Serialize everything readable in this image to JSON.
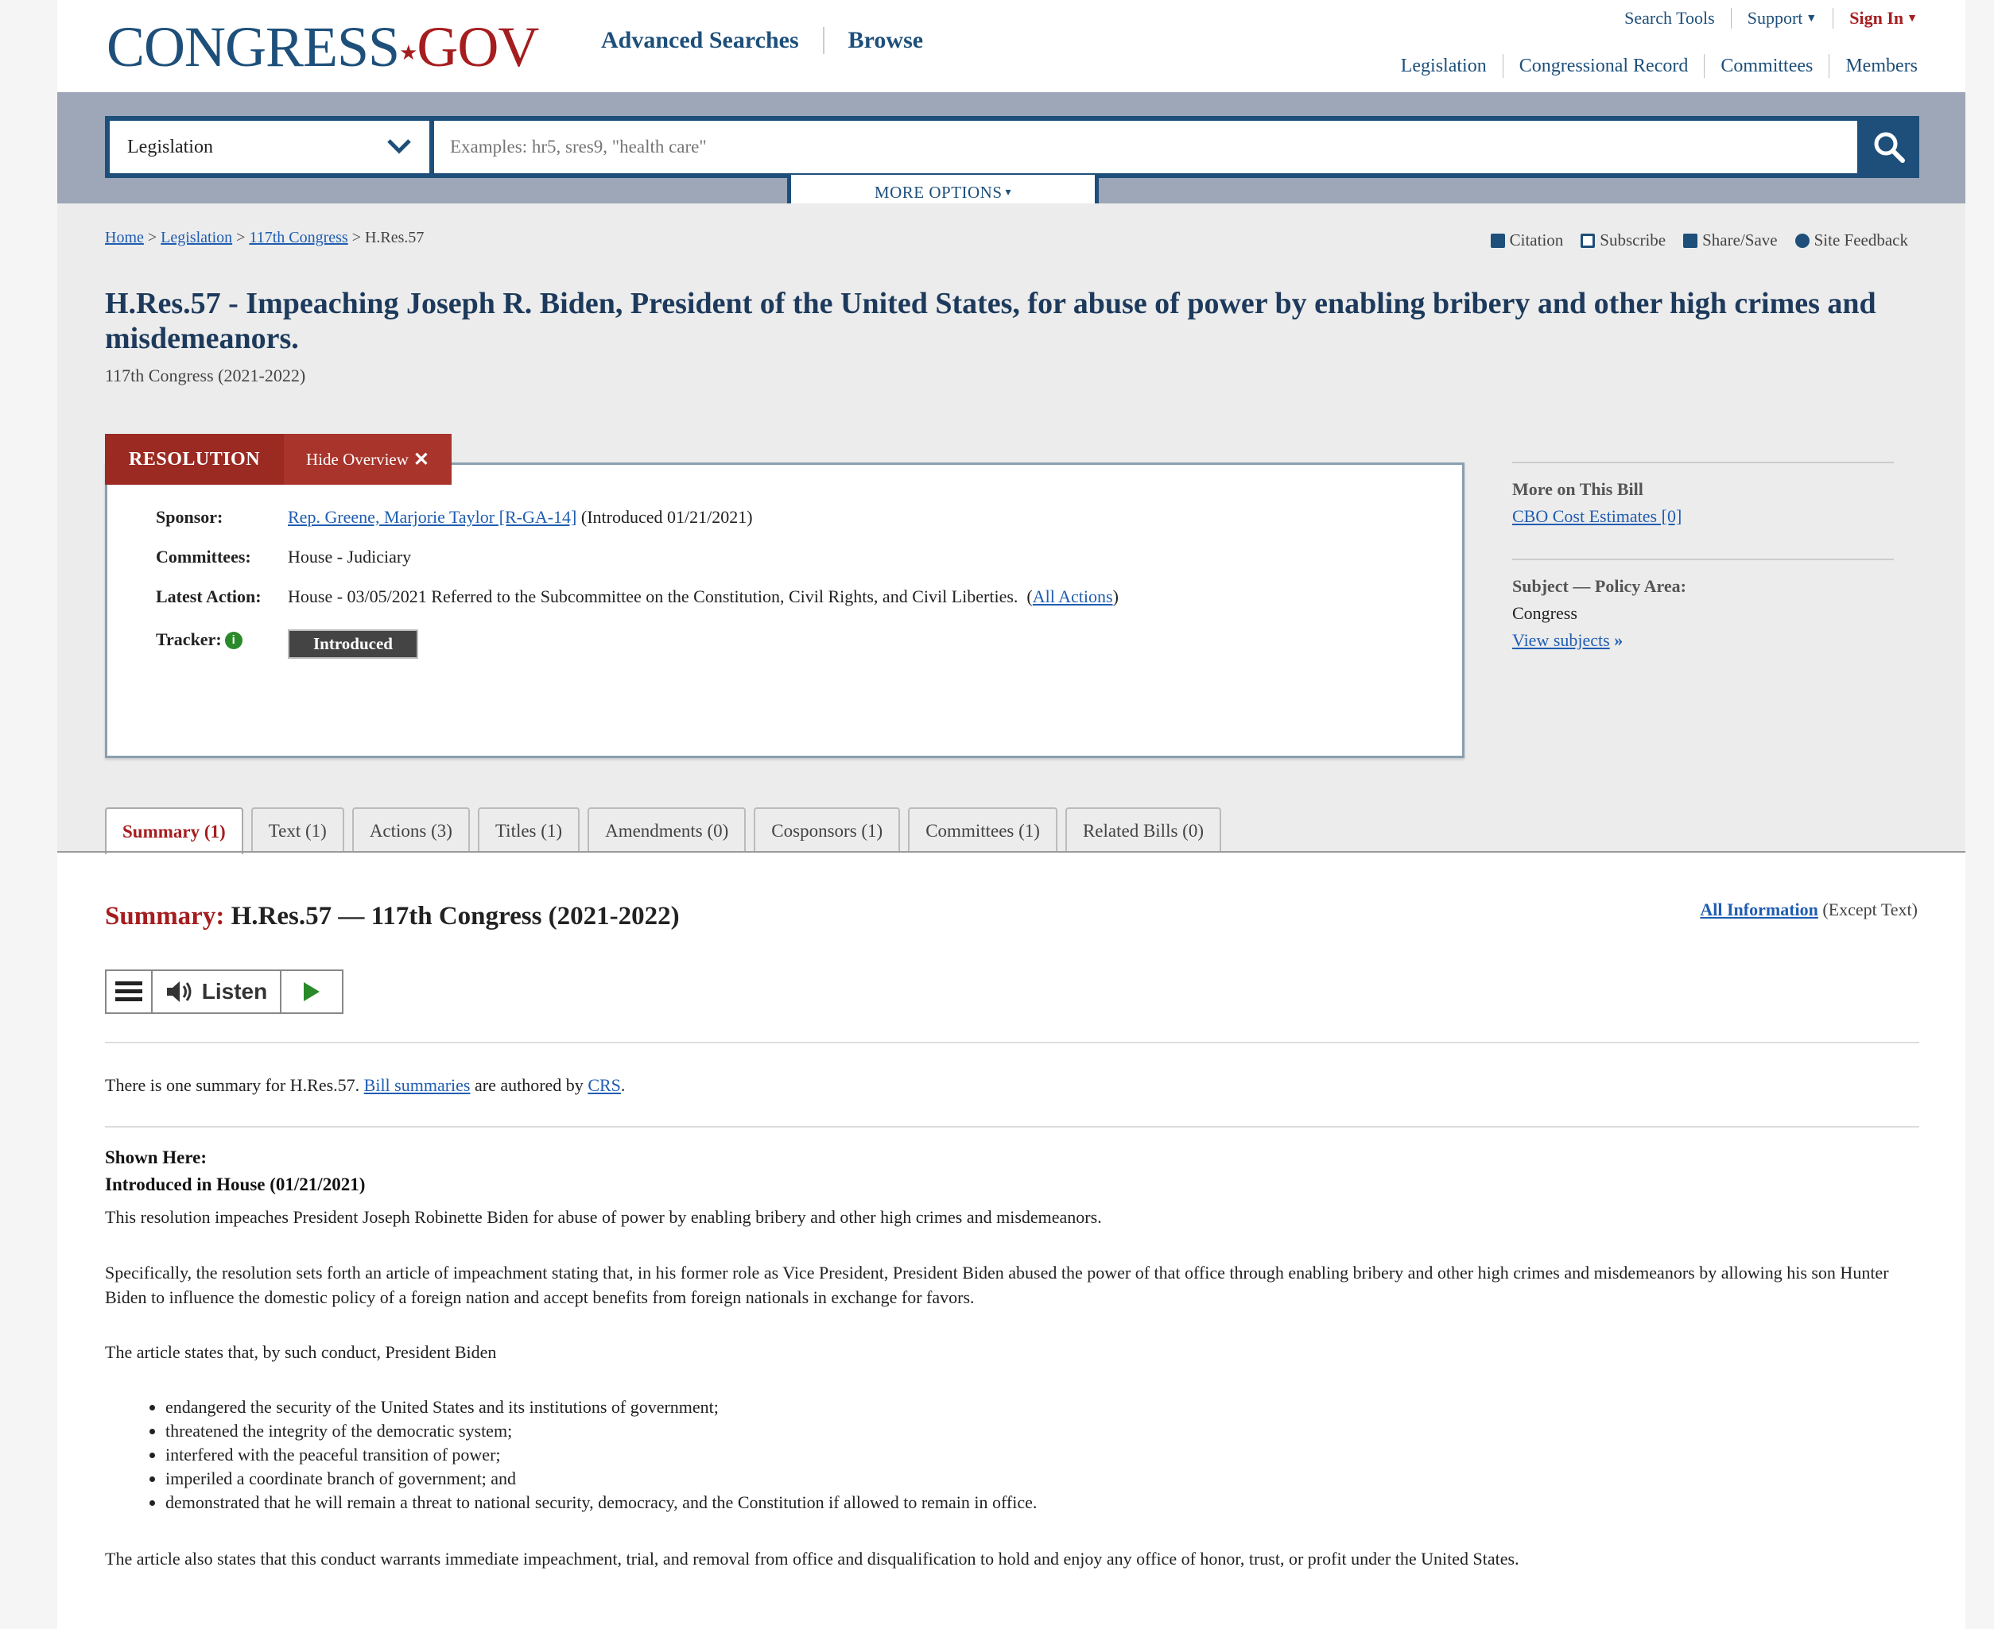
{
  "header": {
    "logo_main": "CONGRESS",
    "logo_dot": ".",
    "logo_gov": "GOV",
    "nav": [
      "Advanced Searches",
      "Browse"
    ],
    "util": {
      "search_tools": "Search Tools",
      "support": "Support",
      "sign_in": "Sign In"
    },
    "subnav": [
      "Legislation",
      "Congressional Record",
      "Committees",
      "Members"
    ]
  },
  "search": {
    "scope": "Legislation",
    "placeholder": "Examples: hr5, sres9, \"health care\"",
    "more_options": "MORE OPTIONS"
  },
  "breadcrumb": {
    "home": "Home",
    "legislation": "Legislation",
    "congress": "117th Congress",
    "current": "H.Res.57",
    "sep": ">"
  },
  "page_tools": [
    "Citation",
    "Subscribe",
    "Share/Save",
    "Site Feedback"
  ],
  "bill": {
    "title": "H.Res.57 - Impeaching Joseph R. Biden, President of the United States, for abuse of power by enabling bribery and other high crimes and misdemeanors.",
    "congress": "117th Congress (2021-2022)",
    "type_label": "RESOLUTION",
    "hide_overview": "Hide Overview",
    "sponsor_label": "Sponsor:",
    "sponsor_link": "Rep. Greene, Marjorie Taylor [R-GA-14]",
    "sponsor_intro": "(Introduced 01/21/2021)",
    "committees_label": "Committees:",
    "committees_value": "House - Judiciary",
    "latest_action_label": "Latest Action:",
    "latest_action_value": "House - 03/05/2021 Referred to the Subcommittee on the Constitution, Civil Rights, and Civil Liberties.",
    "all_actions": "All Actions",
    "tracker_label": "Tracker:",
    "tracker_status": "Introduced"
  },
  "sidebar": {
    "more_heading": "More on This Bill",
    "cbo_link": "CBO Cost Estimates [0]",
    "subject_heading": "Subject — Policy Area:",
    "subject_value": "Congress",
    "view_subjects": "View subjects"
  },
  "tabs": [
    "Summary (1)",
    "Text (1)",
    "Actions (3)",
    "Titles (1)",
    "Amendments (0)",
    "Cosponsors (1)",
    "Committees (1)",
    "Related Bills (0)"
  ],
  "summary": {
    "heading_label": "Summary:",
    "heading_rest": "H.Res.57 — 117th Congress (2021-2022)",
    "all_info": "All Information",
    "except_text": "(Except Text)",
    "listen": "Listen",
    "count_pre": "There is one summary for H.Res.57.",
    "bill_summaries": "Bill summaries",
    "authored_by": "are authored by",
    "crs": "CRS",
    "period": ".",
    "shown_here": "Shown Here:",
    "introduced": "Introduced in House (01/21/2021)",
    "p1": "This resolution impeaches President Joseph Robinette Biden for abuse of power by enabling bribery and other high crimes and misdemeanors.",
    "p2": "Specifically, the resolution sets forth an article of impeachment stating that, in his former role as Vice President, President Biden abused the power of that office through enabling bribery and other high crimes and misdemeanors by allowing his son Hunter Biden to influence the domestic policy of a foreign nation and accept benefits from foreign nationals in exchange for favors.",
    "p3": "The article states that, by such conduct, President Biden",
    "bullets": [
      "endangered the security of the United States and its institutions of government;",
      "threatened the integrity of the democratic system;",
      "interfered with the peaceful transition of power;",
      "imperiled a coordinate branch of government; and",
      "demonstrated that he will remain a threat to national security, democracy, and the Constitution if allowed to remain in office."
    ],
    "p4": "The article also states that this conduct warrants immediate impeachment, trial, and removal from office and disqualification to hold and enjoy any office of honor, trust, or profit under the United States."
  },
  "colors": {
    "brand_blue": "#1d4f7a",
    "brand_red": "#a51d1f",
    "link": "#1f5db1"
  },
  "icons": [
    "chevron-down-icon",
    "search-icon",
    "citation-icon",
    "subscribe-icon",
    "share-icon",
    "feedback-icon",
    "info-icon",
    "close-icon",
    "double-chevron-right-icon",
    "menu-icon",
    "speaker-icon",
    "play-icon"
  ]
}
